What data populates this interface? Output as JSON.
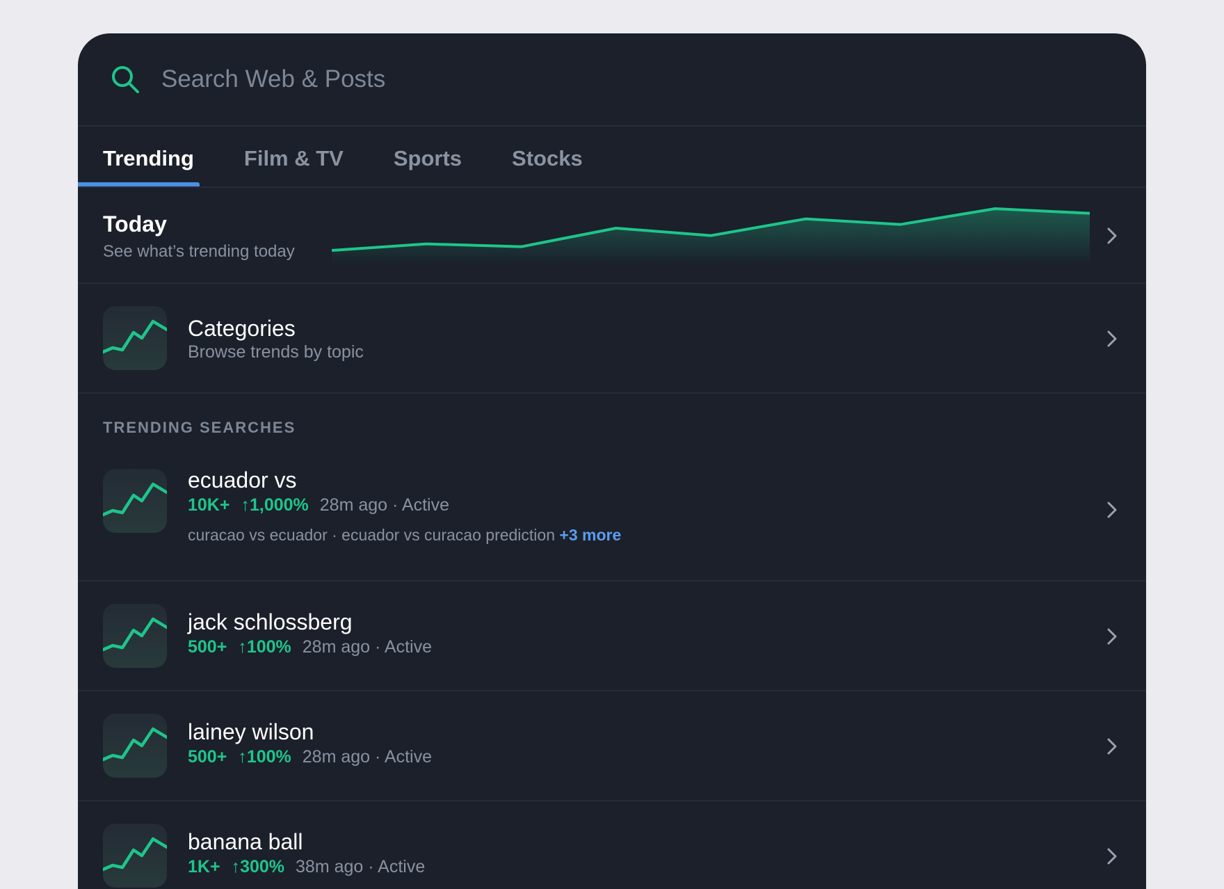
{
  "search": {
    "placeholder": "Search Web & Posts"
  },
  "tabs": [
    {
      "label": "Trending",
      "active": true
    },
    {
      "label": "Film & TV",
      "active": false
    },
    {
      "label": "Sports",
      "active": false
    },
    {
      "label": "Stocks",
      "active": false
    }
  ],
  "today": {
    "title": "Today",
    "subtitle": "See what’s trending today",
    "sparkline": [
      20,
      27,
      24,
      44,
      36,
      54,
      48,
      65,
      60
    ]
  },
  "categories": {
    "title": "Categories",
    "subtitle": "Browse trends by topic"
  },
  "section_label": "TRENDING SEARCHES",
  "trending": [
    {
      "title": "ecuador vs",
      "volume": "10K+",
      "change": "↑1,000%",
      "time": "28m ago · Active",
      "related": "curacao vs ecuador · ecuador vs curacao prediction",
      "more": "+3 more"
    },
    {
      "title": "jack schlossberg",
      "volume": "500+",
      "change": "↑100%",
      "time": "28m ago · Active"
    },
    {
      "title": "lainey wilson",
      "volume": "500+",
      "change": "↑100%",
      "time": "28m ago · Active"
    },
    {
      "title": "banana ball",
      "volume": "1K+",
      "change": "↑300%",
      "time": "38m ago · Active"
    }
  ],
  "colors": {
    "background": "#ebebf0",
    "panel": "#1b202b",
    "accent_green": "#1ec58a",
    "tab_indicator": "#4a90e2",
    "link_blue": "#5b9cf0"
  },
  "icons": {
    "search": "search-icon",
    "chevron": "chevron-right-icon",
    "trend": "trend-line-icon"
  }
}
